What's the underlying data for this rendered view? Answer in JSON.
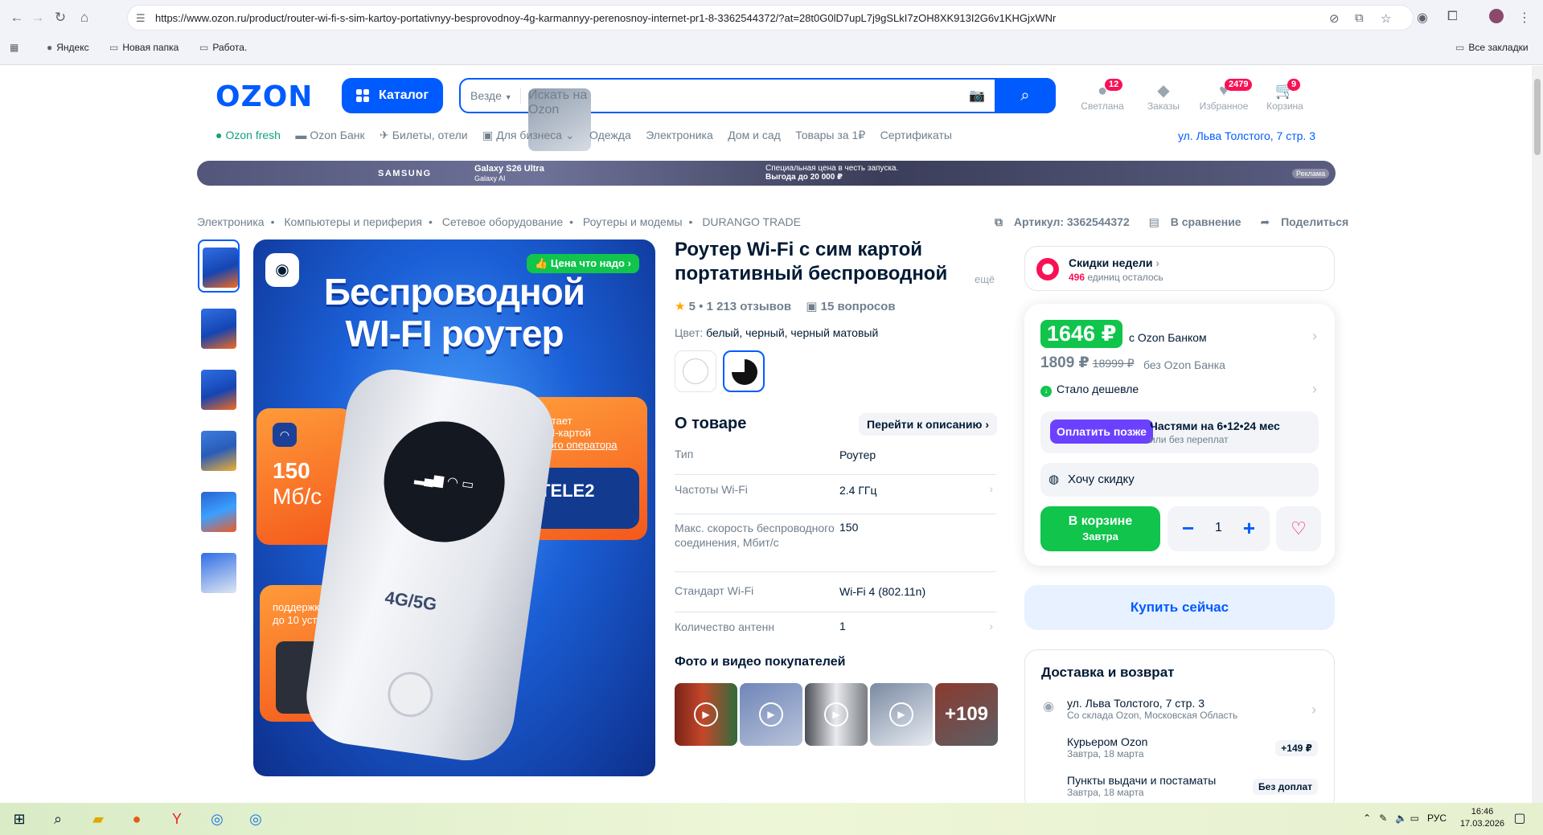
{
  "browser": {
    "url": "https://www.ozon.ru/product/router-wi-fi-s-sim-kartoy-portativnyy-besprovodnoy-4g-karmannyy-perenosnoy-internet-pr1-8-3362544372/?at=28t0G0lD7upL7j9gSLkI7zOH8XK913I2G6v1KHGjxWNr",
    "bookmarks": [
      "Яндекс",
      "Новая папка",
      "Работа."
    ],
    "all_bookmarks": "Все закладки"
  },
  "header": {
    "logo": "OZON",
    "catalog": "Каталог",
    "search_scope": "Везде",
    "search_placeholder": "Искать на Ozon",
    "icons": [
      {
        "label": "Светлана",
        "badge": "12",
        "icon": "user-icon"
      },
      {
        "label": "Заказы",
        "badge": "",
        "icon": "box-icon"
      },
      {
        "label": "Избранное",
        "badge": "2479",
        "icon": "heart-icon"
      },
      {
        "label": "Корзина",
        "badge": "9",
        "icon": "cart-icon"
      }
    ],
    "subnav": [
      "Ozon fresh",
      "Ozon Банк",
      "Билеты, отели",
      "Для бизнеса",
      "Одежда",
      "Электроника",
      "Дом и сад",
      "Товары за 1₽",
      "Сертификаты"
    ],
    "address": "ул. Льва Толстого, 7 стр. 3"
  },
  "banner": {
    "brand": "SAMSUNG",
    "product": "Galaxy S26 Ultra",
    "product_sub": "Galaxy AI",
    "promo1": "Специальная цена в честь запуска.",
    "promo2": "Выгода до 20 000 ₽",
    "ad": "Реклама"
  },
  "breadcrumbs": [
    "Электроника",
    "Компьютеры и периферия",
    "Сетевое оборудование",
    "Роутеры и модемы",
    "DURANGO TRADE"
  ],
  "tools": {
    "article": "Артикул: 3362544372",
    "compare": "В сравнение",
    "share": "Поделиться"
  },
  "gallery": {
    "price_badge": "Цена что надо",
    "headline1": "Беспроводной",
    "headline2": "WI-FI роутер",
    "speed1": "150",
    "speed2": "Мб/с",
    "sim1": "работает",
    "sim2": "с SIM-картой",
    "sim3": "любого оператора",
    "operator": "TELE2",
    "support1": "поддержка",
    "support2": "до 10 устройств",
    "device_label": "4G/5G"
  },
  "product": {
    "title": "Роутер Wi-Fi с сим картой портативный беспроводной 4",
    "more": "ещё",
    "rating": "5",
    "reviews": "1 213 отзывов",
    "questions": "15 вопросов",
    "color_label": "Цвет:",
    "color_value": "белый, черный, черный матовый",
    "about": "О товаре",
    "goto_desc": "Перейти к описанию",
    "specs": [
      {
        "k": "Тип",
        "v": "Роутер"
      },
      {
        "k": "Частоты Wi-Fi",
        "v": "2.4 ГГц"
      },
      {
        "k": "Макс. скорость беспроводного соединения, Мбит/с",
        "v": "150"
      },
      {
        "k": "Стандарт Wi-Fi",
        "v": "Wi-Fi 4 (802.11n)"
      },
      {
        "k": "Количество антенн",
        "v": "1"
      }
    ],
    "photos_title": "Фото и видео покупателей",
    "photos_more": "+109"
  },
  "deal": {
    "title": "Скидки недели",
    "count": "496",
    "count_suffix": "единиц осталось"
  },
  "price": {
    "ozon": "1646 ₽",
    "ozon_label": "с Ozon Банком",
    "regular": "1809 ₽",
    "old": "18999 ₽",
    "regular_label": "без Ozon Банка",
    "cheaper": "Стало дешевле",
    "pay_later": "Оплатить позже",
    "parts": "Частями на 6•12•24 мес",
    "parts_sub": "или без переплат",
    "want_discount": "Хочу скидку",
    "in_cart": "В корзине",
    "in_cart_sub": "Завтра",
    "qty": "1",
    "buy_now": "Купить сейчас"
  },
  "delivery": {
    "title": "Доставка и возврат",
    "address": "ул. Льва Толстого, 7 стр. 3",
    "address_sub": "Со склада Ozon, Московская Область",
    "courier": "Курьером Ozon",
    "courier_date": "Завтра, 18 марта",
    "courier_price": "+149 ₽",
    "pickup": "Пункты выдачи и постаматы",
    "pickup_date": "Завтра, 18 марта",
    "pickup_price": "Без доплат"
  },
  "taskbar": {
    "lang": "РУС",
    "time": "16:46",
    "date": "17.03.2026"
  },
  "colors": {
    "ozon_blue": "#005bff",
    "green": "#10c44c",
    "pink": "#f91155",
    "purple": "#6b41ff"
  }
}
